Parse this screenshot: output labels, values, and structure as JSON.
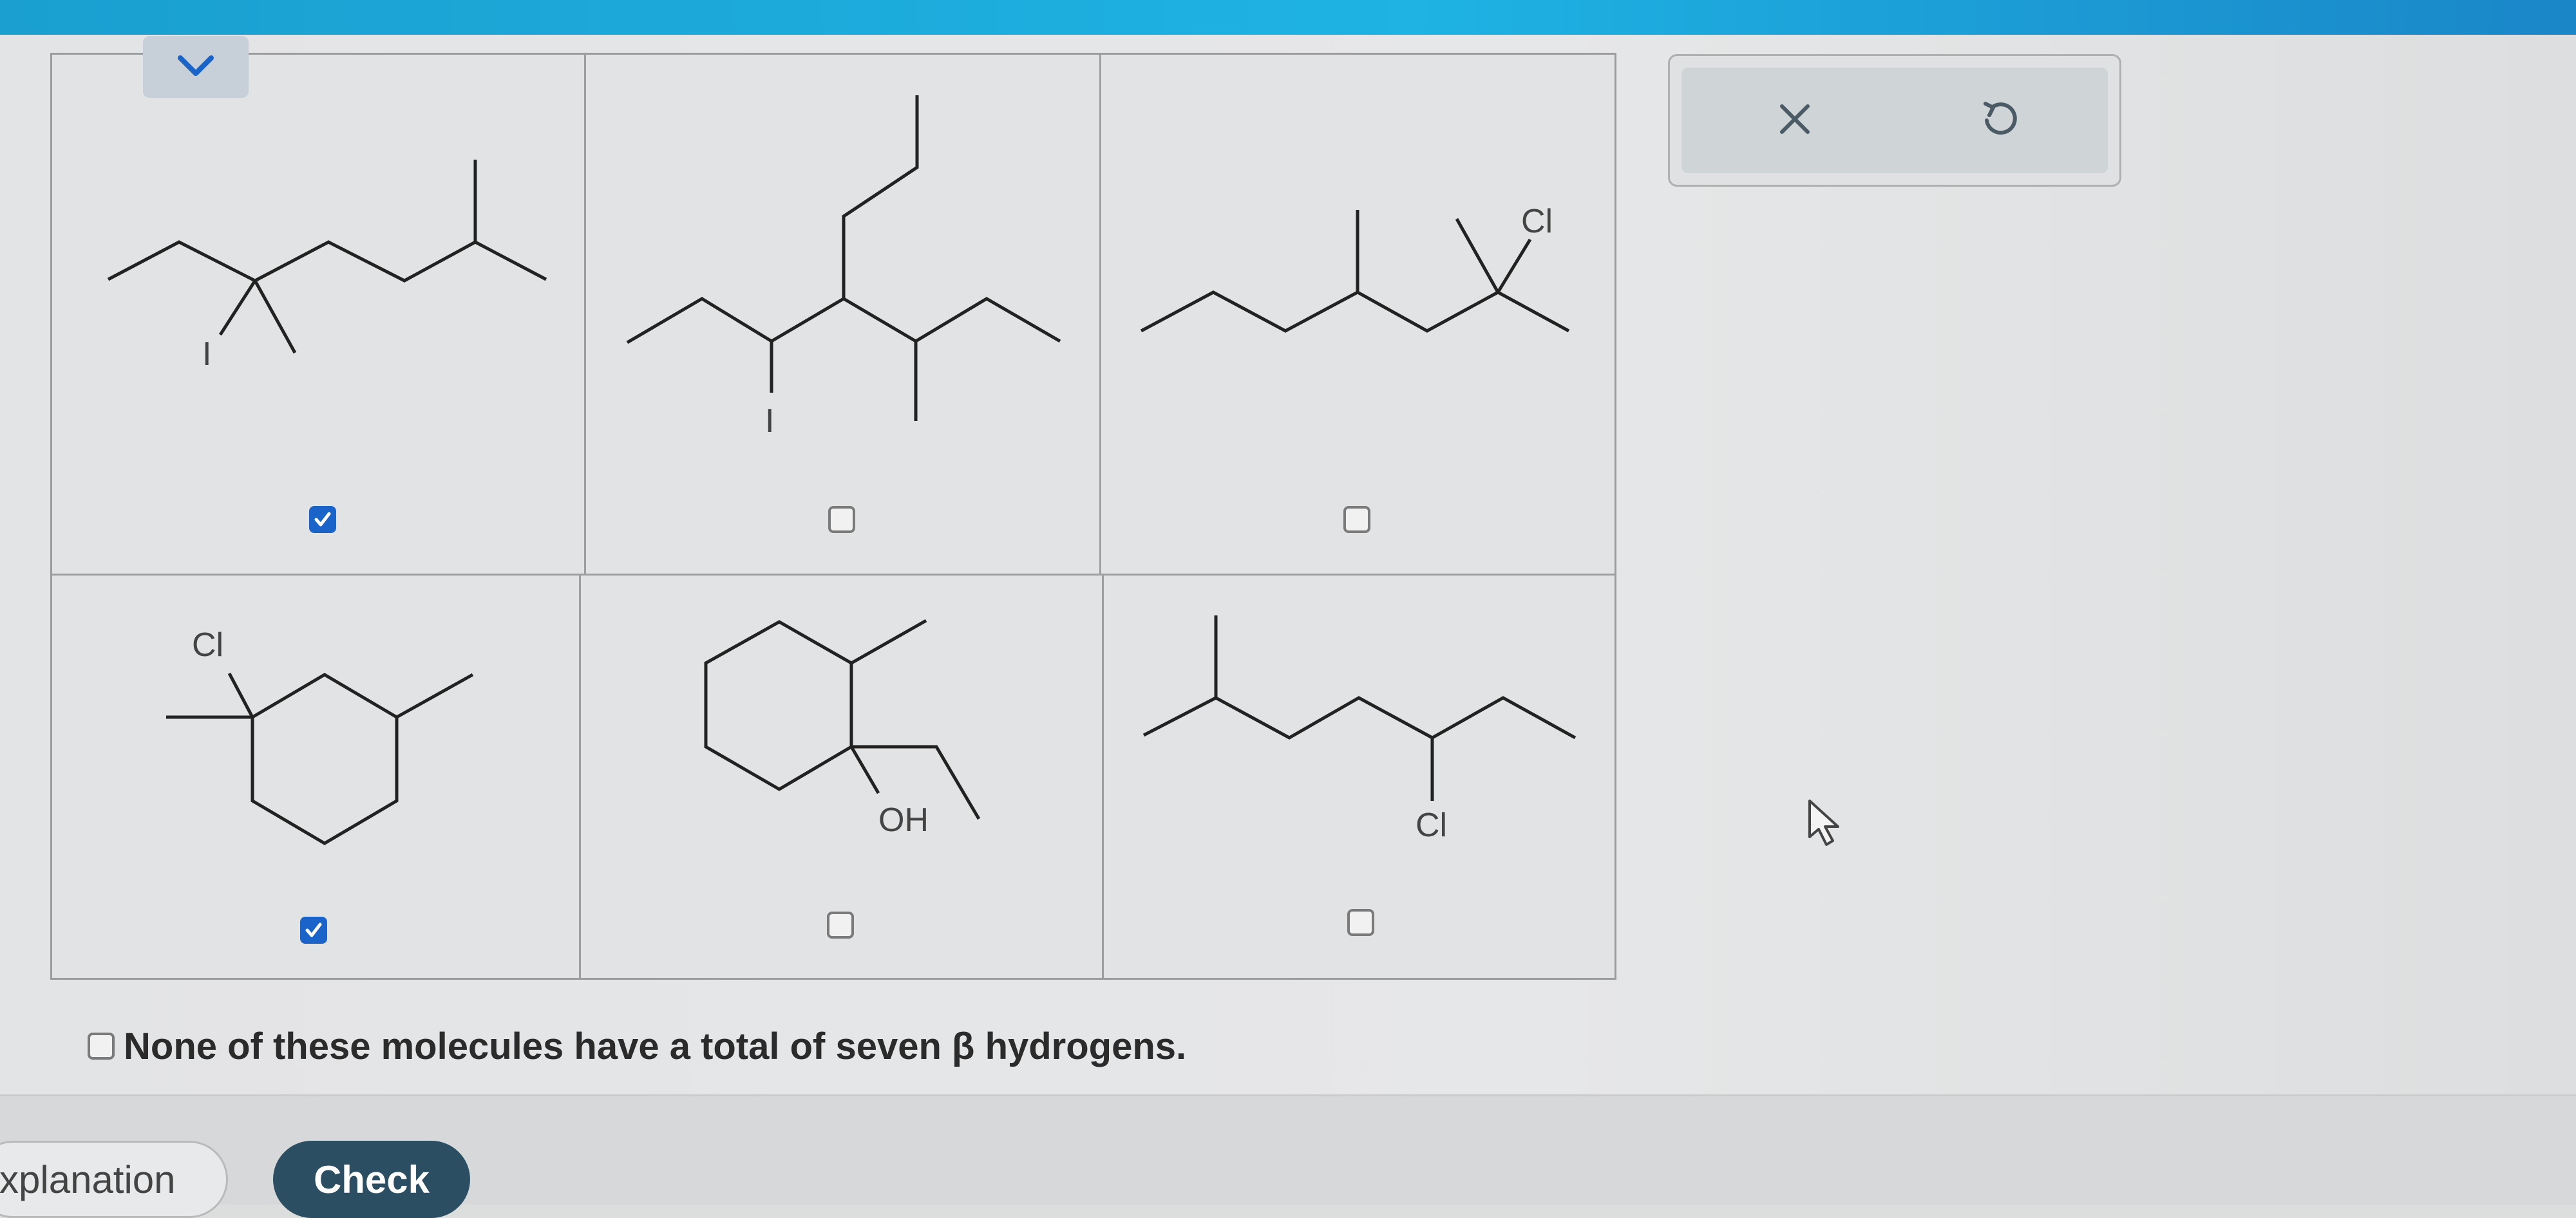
{
  "header": {
    "collapse_icon": "chevron-down-icon"
  },
  "molecules": [
    {
      "id": "m1",
      "labels": [
        "I"
      ],
      "checked": true
    },
    {
      "id": "m2",
      "labels": [
        "I"
      ],
      "checked": false
    },
    {
      "id": "m3",
      "labels": [
        "Cl"
      ],
      "checked": false
    },
    {
      "id": "m4",
      "labels": [
        "Cl"
      ],
      "checked": true
    },
    {
      "id": "m5",
      "labels": [
        "OH"
      ],
      "checked": false
    },
    {
      "id": "m6",
      "labels": [
        "Cl"
      ],
      "checked": false
    }
  ],
  "none_option": {
    "label": "None of these molecules have a total of seven β hydrogens.",
    "checked": false
  },
  "toolbox": {
    "close_icon": "close-icon",
    "undo_icon": "undo-icon"
  },
  "footer": {
    "explanation_label": "xplanation",
    "check_label": "Check"
  },
  "colors": {
    "accent": "#1a63c8",
    "check_button": "#2c4e63",
    "topbar": "#1eb3e3"
  }
}
